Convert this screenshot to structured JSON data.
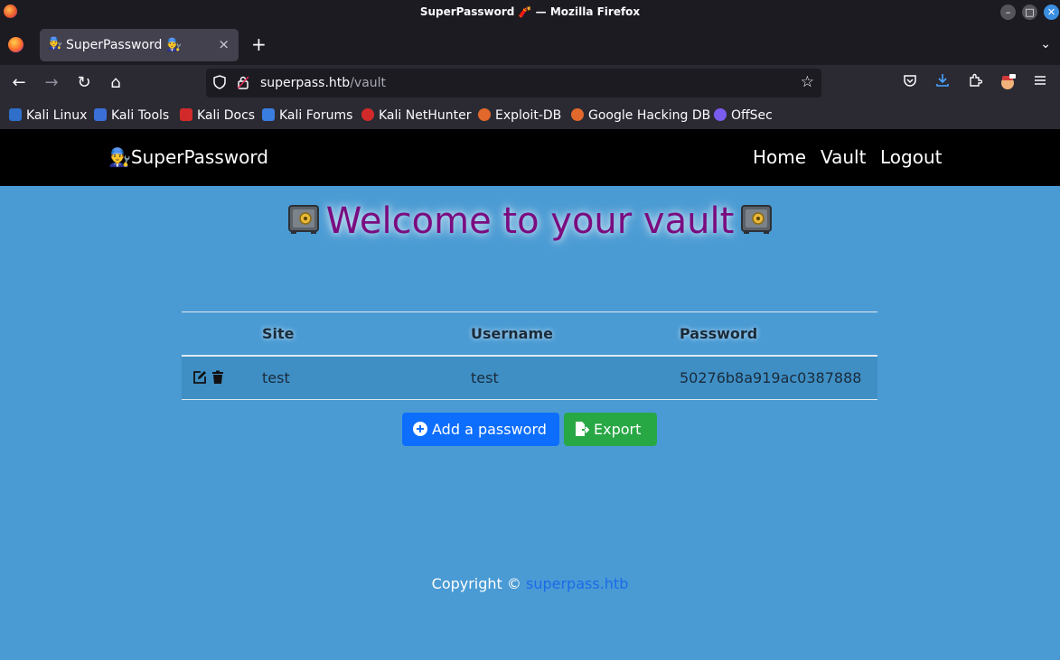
{
  "window": {
    "title": "SuperPassword 🧨 — Mozilla Firefox",
    "minimize": "–",
    "maximize": "□",
    "close": "✕"
  },
  "tabs": [
    {
      "icon": "👨‍🔧",
      "label": "SuperPassword 👨‍🔧",
      "close": "×"
    }
  ],
  "tabstrip": {
    "new_tab": "+",
    "list_all": "⌄"
  },
  "navigation": {
    "back": "←",
    "forward": "→",
    "reload": "↻",
    "home": "⌂",
    "url_host": "superpass.htb",
    "url_path": "/vault",
    "bookmark_star": "☆"
  },
  "bookmarks": [
    {
      "label": "Kali Linux",
      "color": "#2f6fc9"
    },
    {
      "label": "Kali Tools",
      "color": "#3a6fd8"
    },
    {
      "label": "Kali Docs",
      "color": "#d22a2a"
    },
    {
      "label": "Kali Forums",
      "color": "#3a7de0"
    },
    {
      "label": "Kali NetHunter",
      "color": "#d22a2a"
    },
    {
      "label": "Exploit-DB",
      "color": "#e2682b"
    },
    {
      "label": "Google Hacking DB",
      "color": "#e2682b"
    },
    {
      "label": "OffSec",
      "color": "#7a5cf0"
    }
  ],
  "site": {
    "brand_icon": "👨‍🔧",
    "brand": "SuperPassword",
    "menu": [
      "Home",
      "Vault",
      "Logout"
    ]
  },
  "main": {
    "heading": "Welcome to your vault",
    "table": {
      "columns": [
        "",
        "Site",
        "Username",
        "Password"
      ],
      "rows": [
        {
          "site": "test",
          "username": "test",
          "password": "50276b8a919ac0387888"
        }
      ]
    },
    "add_button": "Add a password",
    "export_button": "Export"
  },
  "footer": {
    "text": "Copyright © ",
    "link": "superpass.htb"
  },
  "colors": {
    "page_bg": "#4a9bd4",
    "heading": "#7a0c80",
    "add_button": "#0d6efd",
    "export_button": "#28a745"
  }
}
